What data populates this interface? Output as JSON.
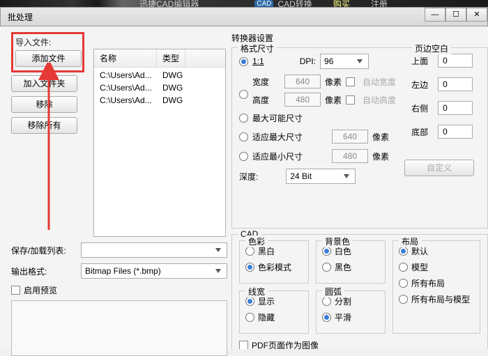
{
  "top": {
    "app_hint": "迅捷CAD编辑器",
    "badge": "CAD",
    "convert": "CAD转换",
    "buy": "购买",
    "reg": "注册"
  },
  "window": {
    "title": "批处理"
  },
  "left": {
    "import_label": "导入文件:",
    "add_file": "添加文件",
    "add_folder": "加入文件夹",
    "remove": "移除",
    "remove_all": "移除所有",
    "col_name": "名称",
    "col_type": "类型",
    "files": [
      {
        "name": "C:\\Users\\Ad...",
        "type": "DWG"
      },
      {
        "name": "C:\\Users\\Ad...",
        "type": "DWG"
      },
      {
        "name": "C:\\Users\\Ad...",
        "type": "DWG"
      }
    ],
    "save_list": "保存/加载列表:",
    "output_fmt": "输出格式:",
    "output_fmt_value": "Bitmap Files (*.bmp)",
    "enable_preview": "启用预览"
  },
  "right": {
    "settings_title": "转换器设置",
    "format_size": "格式尺寸",
    "page_margin": "页边空白",
    "ratio": "1:1",
    "dpi_label": "DPI:",
    "dpi_value": "96",
    "width_label": "宽度",
    "width_val": "640",
    "px": "像素",
    "auto_w": "自动宽度",
    "height_label": "高度",
    "height_val": "480",
    "auto_h": "自动高度",
    "max_possible": "最大可能尺寸",
    "fit_max": "适应最大尺寸",
    "fit_max_val": "640",
    "fit_min": "适应最小尺寸",
    "fit_min_val": "480",
    "depth_label": "深度:",
    "depth_value": "24 Bit",
    "custom": "自定义",
    "margins": {
      "top": "上面",
      "left": "左边",
      "right": "右侧",
      "bottom": "底部",
      "v": "0"
    },
    "cad": {
      "title": "CAD",
      "color": "色彩",
      "bw": "黑白",
      "colormode": "色彩模式",
      "bgcolor": "背景色",
      "white": "白色",
      "black": "黑色",
      "linew": "线宽",
      "show": "显示",
      "hide": "隐藏",
      "arc": "圆弧",
      "split": "分割",
      "smooth": "平滑",
      "layout": "布局",
      "def": "默认",
      "model": "模型",
      "all": "所有布局",
      "allm": "所有布局与模型",
      "pdf_as_image": "PDF页面作为图像"
    }
  }
}
